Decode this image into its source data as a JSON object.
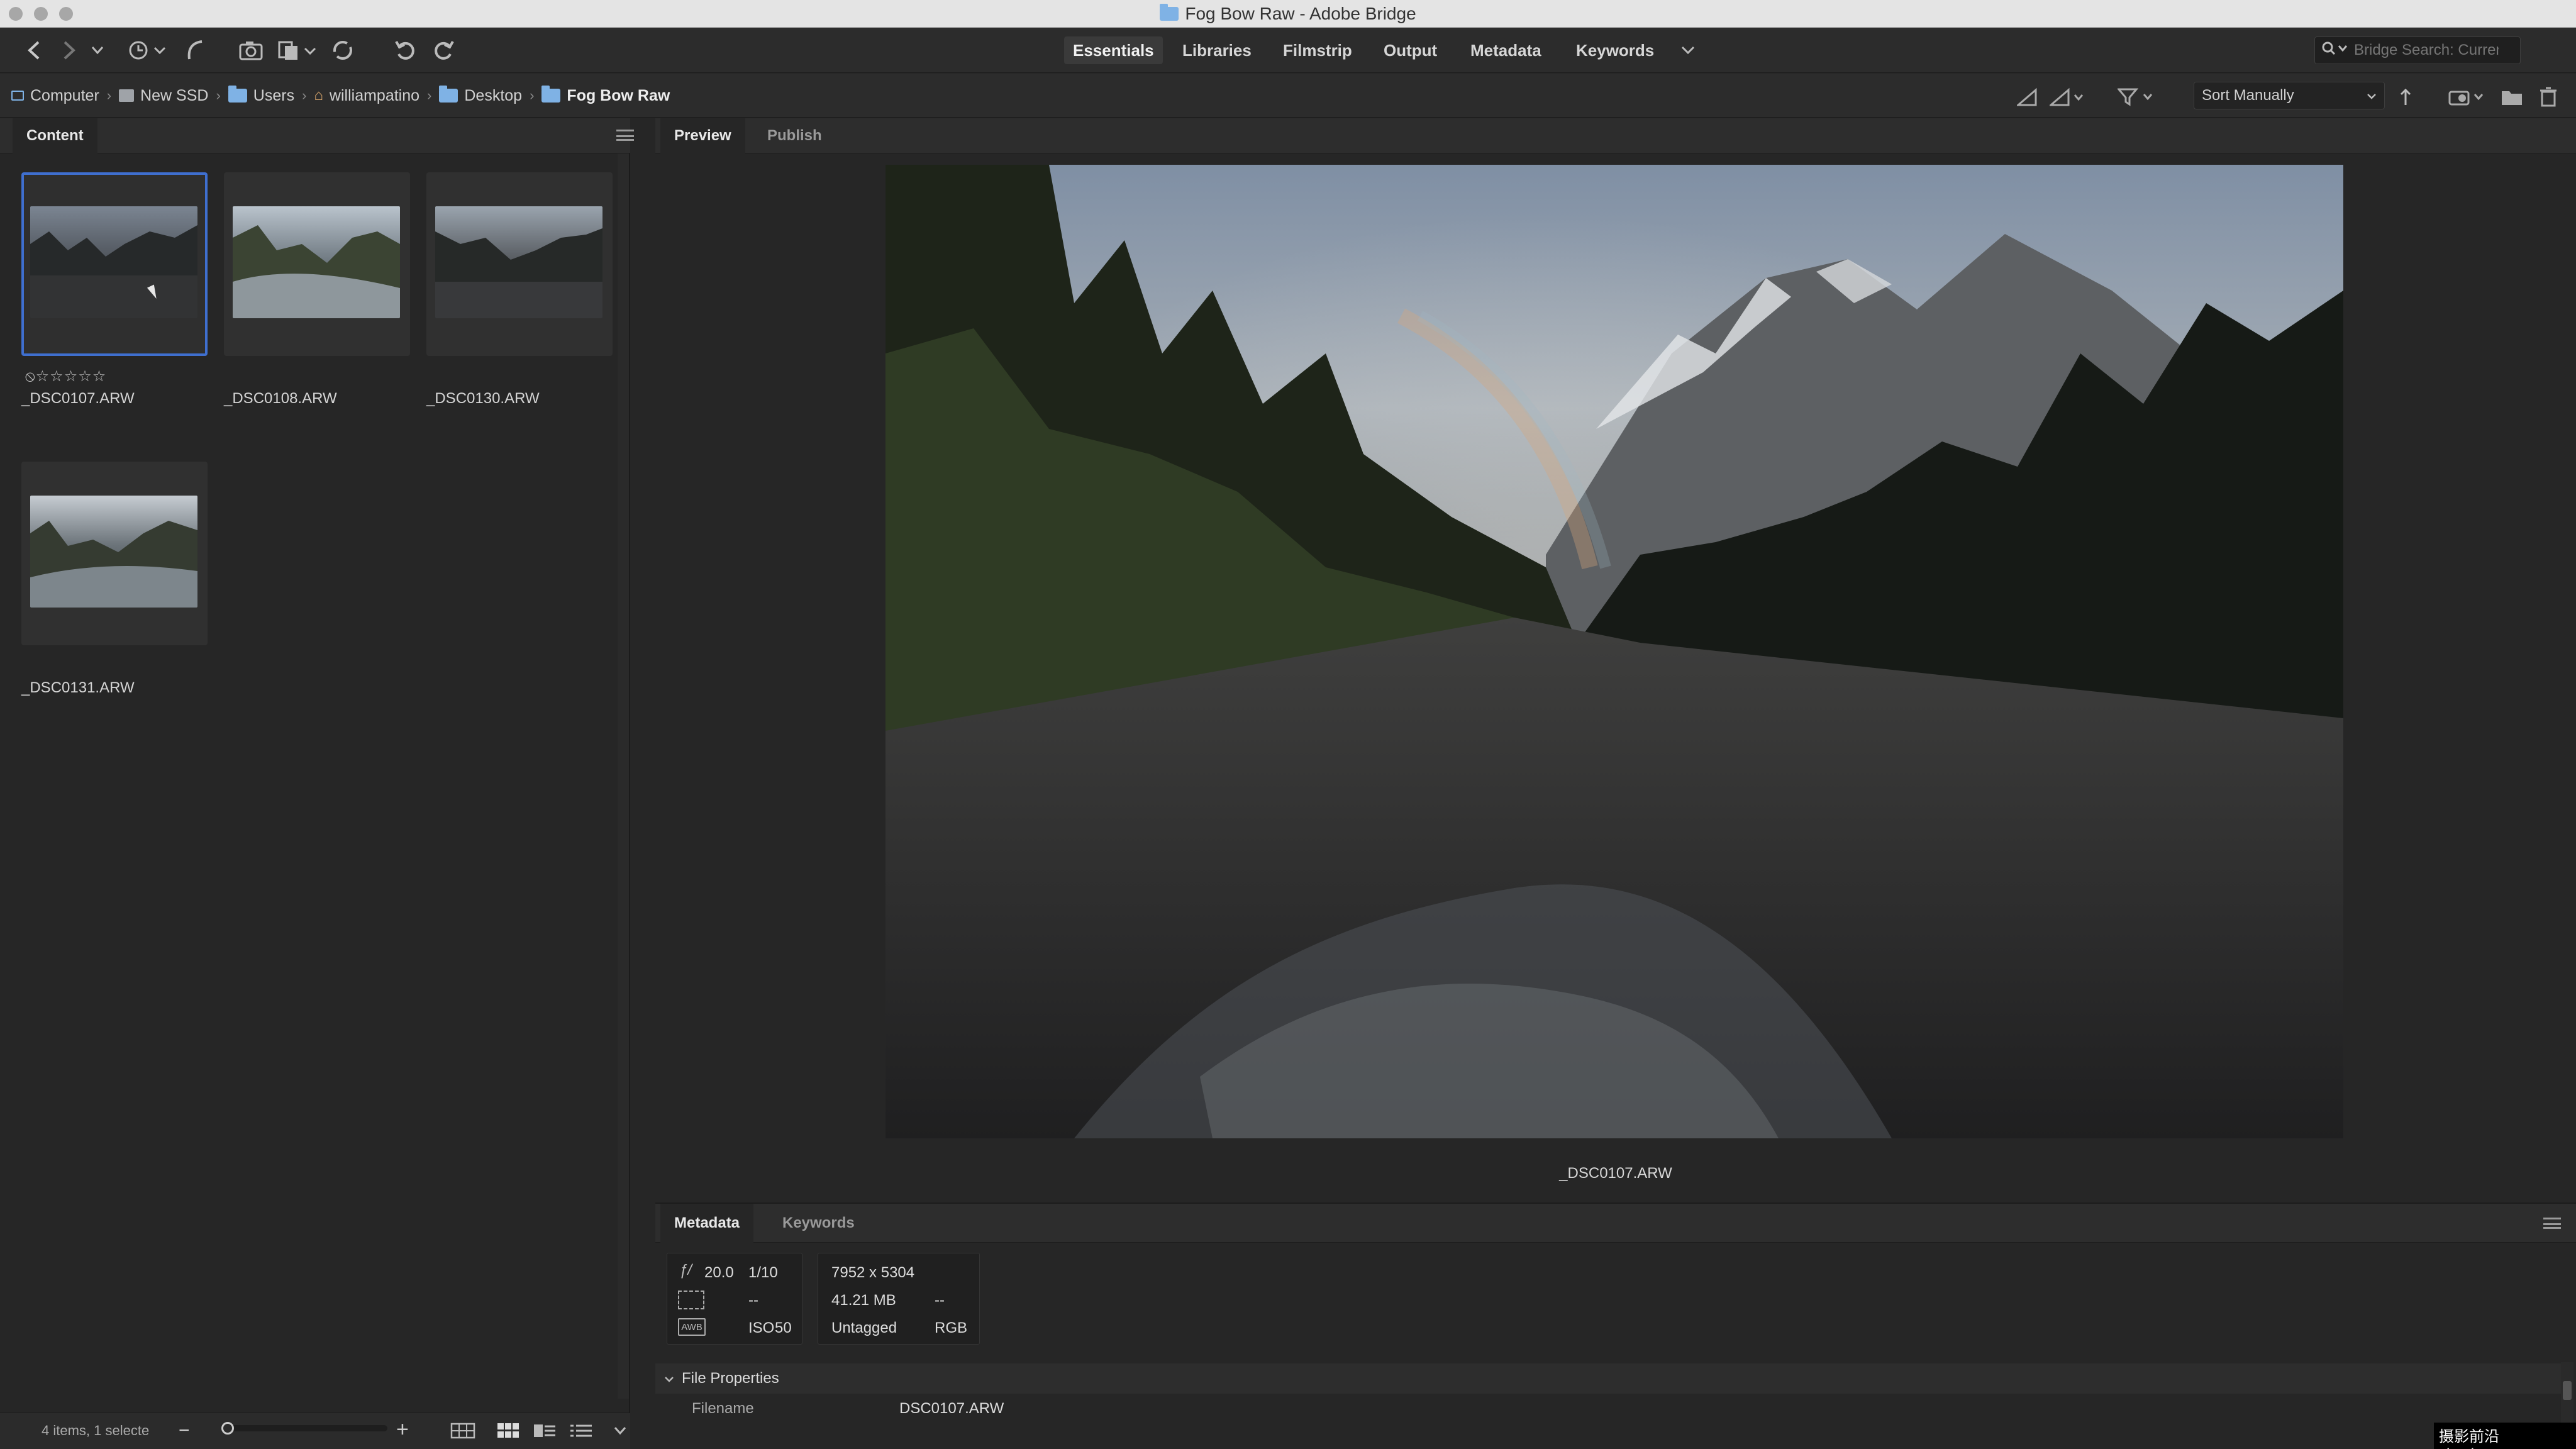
{
  "window": {
    "title": "Fog Bow Raw - Adobe Bridge"
  },
  "toolbar": {
    "workspaces": [
      {
        "label": "Essentials",
        "active": true
      },
      {
        "label": "Libraries",
        "active": false
      },
      {
        "label": "Filmstrip",
        "active": false
      },
      {
        "label": "Output",
        "active": false
      },
      {
        "label": "Metadata",
        "active": false
      },
      {
        "label": "Keywords",
        "active": false
      }
    ],
    "search_placeholder": "Bridge Search: Current..."
  },
  "breadcrumb": [
    "Computer",
    "New SSD",
    "Users",
    "williampatino",
    "Desktop",
    "Fog Bow Raw"
  ],
  "sort": {
    "label": "Sort Manually"
  },
  "content_panel": {
    "tab": "Content",
    "items": [
      {
        "filename": "_DSC0107.ARW",
        "selected": true,
        "rating": 0
      },
      {
        "filename": "_DSC0108.ARW",
        "selected": false
      },
      {
        "filename": "_DSC0130.ARW",
        "selected": false
      },
      {
        "filename": "_DSC0131.ARW",
        "selected": false
      }
    ],
    "status": "4 items, 1 selecte"
  },
  "preview": {
    "tabs": [
      "Preview",
      "Publish"
    ],
    "caption": "_DSC0107.ARW"
  },
  "metadata": {
    "tabs": [
      "Metadata",
      "Keywords"
    ],
    "aperture": "20.0",
    "shutter": "1/10",
    "metering": "--",
    "iso_label": "ISO",
    "iso": "50",
    "dimensions": "7952 x 5304",
    "size": "41.21 MB",
    "resolution": "--",
    "color_profile": "Untagged",
    "color_mode": "RGB",
    "white_balance_badge": "AWB",
    "aperture_glyph": "ƒ/",
    "section_title": "File Properties",
    "filename_label": "Filename",
    "filename_value": "DSC0107.ARW"
  },
  "watermark": "摄影前沿 sheyingqy.com",
  "colors": {
    "accent": "#3f6fcf",
    "panel": "#262626",
    "toolbar": "#2c2c2c"
  }
}
